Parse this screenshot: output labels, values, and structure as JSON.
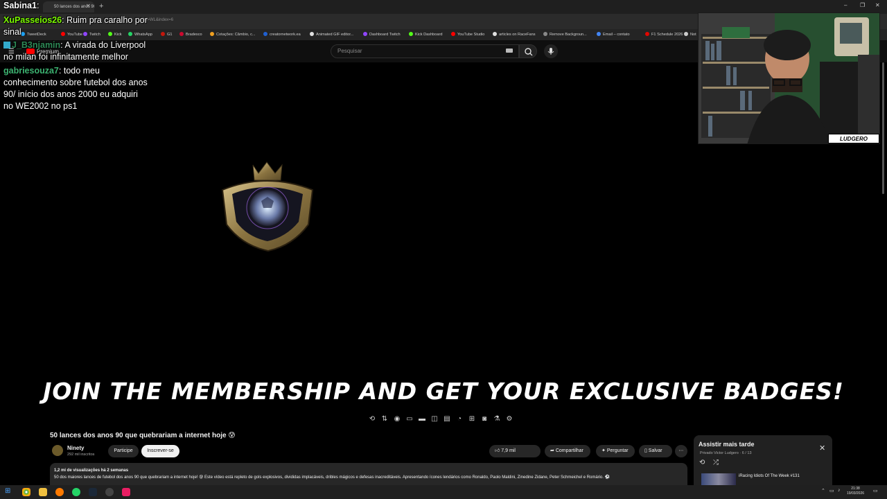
{
  "browser": {
    "tab_title": "50 lances dos anos 90 que quebr...",
    "url": "...list=WL&index=6",
    "bookmarks": [
      {
        "label": "TweetDeck",
        "color": "#1da1f2"
      },
      {
        "label": "YouTube",
        "color": "#ff0000"
      },
      {
        "label": "Twitch",
        "color": "#9146ff"
      },
      {
        "label": "Kick",
        "color": "#53fc18"
      },
      {
        "label": "WhatsApp",
        "color": "#25d366"
      },
      {
        "label": "G1",
        "color": "#c4170c"
      },
      {
        "label": "Bradesco",
        "color": "#cc092f"
      },
      {
        "label": "Cotações: Câmbio, c...",
        "color": "#f0a020"
      },
      {
        "label": "creatornetwork.ea",
        "color": "#2060d0"
      },
      {
        "label": "Animated GIF editor...",
        "color": "#e0e0e0"
      },
      {
        "label": "Dashboard Twitch",
        "color": "#9146ff"
      },
      {
        "label": "Kick Dashboard",
        "color": "#53fc18"
      },
      {
        "label": "YouTube Studio",
        "color": "#ff0000"
      },
      {
        "label": "articles on RaceFans",
        "color": "#e0e0e0"
      },
      {
        "label": "Remove Backgroun...",
        "color": "#888888"
      },
      {
        "label": "Email – contato",
        "color": "#4285f4"
      },
      {
        "label": "F1 Schedule 2026",
        "color": "#e10600"
      },
      {
        "label": "Not",
        "color": "#cccccc"
      }
    ]
  },
  "youtube": {
    "logo_text": "Premium",
    "search_placeholder": "Pesquisar"
  },
  "video": {
    "promo_text": "JOIN THE MEMBERSHIP AND GET YOUR EXCLUSIVE BADGES!",
    "title": "50 lances dos anos 90 que quebrariam a internet hoje 😰",
    "channel_name": "Ninety",
    "channel_subs": "292 mil inscritos",
    "join_label": "Participe",
    "subscribe_label": "Inscrever-se",
    "likes": "7,9 mil",
    "share_label": "Compartilhar",
    "ask_label": "Perguntar",
    "save_label": "Salvar",
    "views_date": "1,2 mi de visualizações  há 2 semanas",
    "description": "50 dos maiores lances de futebol dos anos 90 que quebrariam a internet hoje! 😰 Este vídeo está repleto de gols explosivos, divididas implacáveis, dribles mágicos e defesas inacreditáveis. Apresentando ícones lendários como Ronaldo, Paolo Maldini, Zinedine Zidane, Peter Schmeichel e Romário. ⚽"
  },
  "chat": {
    "messages": [
      {
        "user": "Sabina1",
        "text": "",
        "color": "#ffffff"
      },
      {
        "user": "XuPasseios26",
        "text": "Ruim pra caralho por sinal",
        "color": "#7cfc00"
      },
      {
        "user": "J_B3njamin",
        "text": "A virada do Liverpool no milan foi infinitamente melhor",
        "color": "#2e8b57"
      },
      {
        "user": "gabriesouza7",
        "text": "todo meu conhecimento sobre futebol dos anos 90/ início dos anos 2000 eu adquiri no WE2002 no ps1",
        "color": "#3cb371"
      }
    ]
  },
  "webcam": {
    "tag": "LUDGERO"
  },
  "watch_later": {
    "title": "Assistir mais tarde",
    "meta": "Privado  Victor Ludgero · 6 / 13",
    "item_title": "iRacing Idiots Of The Week #131"
  },
  "taskbar": {
    "time": "21:38",
    "date": "19/03/2026"
  }
}
